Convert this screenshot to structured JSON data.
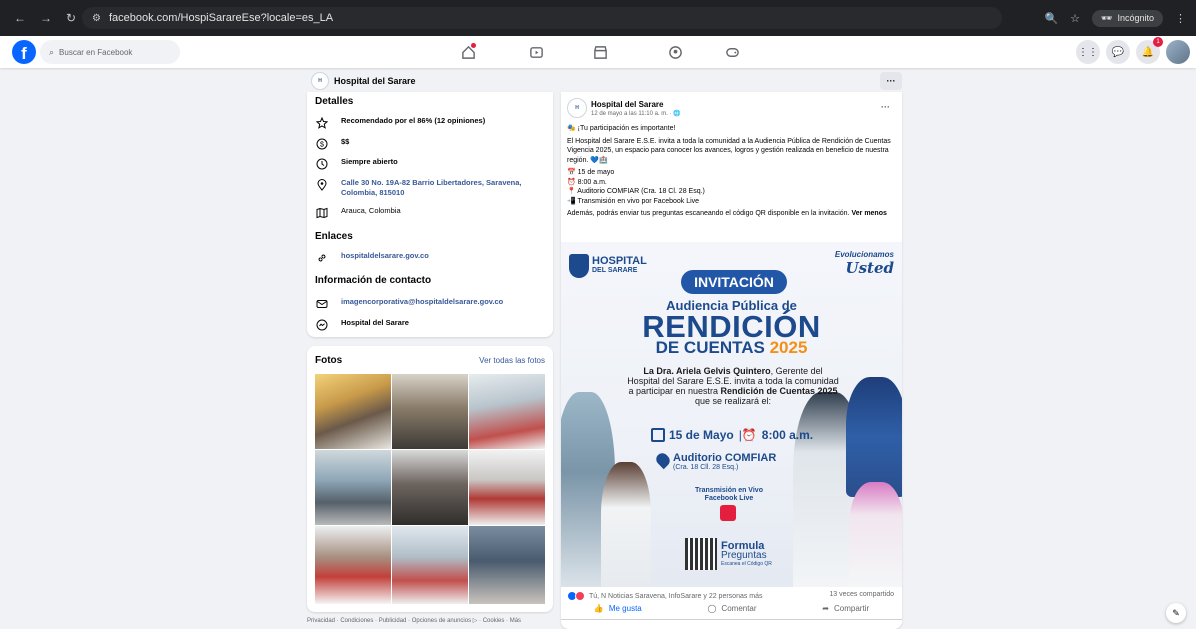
{
  "browser": {
    "url": "facebook.com/HospiSarareEse?locale=es_LA",
    "incognito_label": "Incógnito"
  },
  "fb_header": {
    "search_placeholder": "Buscar en Facebook",
    "notification_count": "1"
  },
  "page": {
    "name": "Hospital del Sarare",
    "logo_text": "H"
  },
  "details": {
    "title": "Detalles",
    "items": [
      {
        "icon": "star-icon",
        "text": "Recomendado por el 86% (12 opiniones)"
      },
      {
        "icon": "price-icon",
        "text": "$$"
      },
      {
        "icon": "clock-icon",
        "text": "Siempre abierto"
      },
      {
        "icon": "location-pin-icon",
        "text": "Calle 30 No. 19A-82 Barrio Libertadores, Saravena, Colombia, 815010"
      },
      {
        "icon": "map-icon",
        "text": "Arauca, Colombia"
      }
    ]
  },
  "links": {
    "title": "Enlaces",
    "website": "hospitaldelsarare.gov.co"
  },
  "contact": {
    "title": "Información de contacto",
    "email": "imagencorporativa@hospitaldelsarare.gov.co",
    "messenger": "Hospital del Sarare"
  },
  "photos": {
    "title": "Fotos",
    "see_all": "Ver todas las fotos"
  },
  "footer": {
    "links": "Privacidad · Condiciones · Publicidad · Opciones de anuncios ▷ · Cookies · Más"
  },
  "post": {
    "author": "Hospital del Sarare",
    "date": "12 de mayo a las 11:10 a. m. · 🌐",
    "line1": "🎭 ¡Tu participación es importante!",
    "line2": "El Hospital del Sarare E.S.E. invita a toda la comunidad a la Audiencia Pública de Rendición de Cuentas Vigencia 2025, un espacio para conocer los avances, logros y gestión realizada en beneficio de nuestra región. 💙🏥",
    "list": [
      "📅 15 de mayo",
      "⏰ 8:00 a.m.",
      "📍 Auditorio COMFIAR (Cra. 18 Cl. 28 Esq.)",
      "📲 Transmisión en vivo por Facebook Live"
    ],
    "outro": "Además, podrás enviar tus preguntas escaneando el código QR disponible en la invitación.",
    "see_less": "Ver menos",
    "reactions_text": "Tú, N Noticias Saravena, InfoSarare y 22 personas más",
    "shares_text": "13 veces compartido",
    "like_label": "Me gusta",
    "comment_label": "Comentar",
    "share_label": "Compartir"
  },
  "invitation": {
    "logo_line1": "HOSPITAL",
    "logo_line2": "DEL SARARE",
    "slogan_top": "Evolucionamos",
    "slogan_bottom": "Usted",
    "badge": "INVITACIÓN",
    "line1": "Audiencia Pública de",
    "line2": "RENDICIÓN",
    "line3": "DE CUENTAS",
    "year": "2025",
    "body_bold": "La Dra. Ariela Gelvis Quintero",
    "body_rest": ", Gerente del Hospital del Sarare E.S.E. invita a toda la comunidad a participar en nuestra",
    "body_bold2": "Rendición de Cuentas 2025",
    "body_end": " que se realizará el:",
    "date": "15 de Mayo",
    "time": "8:00 a.m.",
    "place": "Auditorio COMFIAR",
    "place_sub": "(Cra. 18 Cll. 28 Esq.)",
    "live": "Transmisión en Vivo Facebook Live",
    "qr1": "Formula",
    "qr2": "Preguntas",
    "qr3": "Escanea el Código QR"
  },
  "colors": {
    "fb_blue": "#0866ff",
    "brand_navy": "#1c4a8c",
    "accent_orange": "#f29018"
  }
}
